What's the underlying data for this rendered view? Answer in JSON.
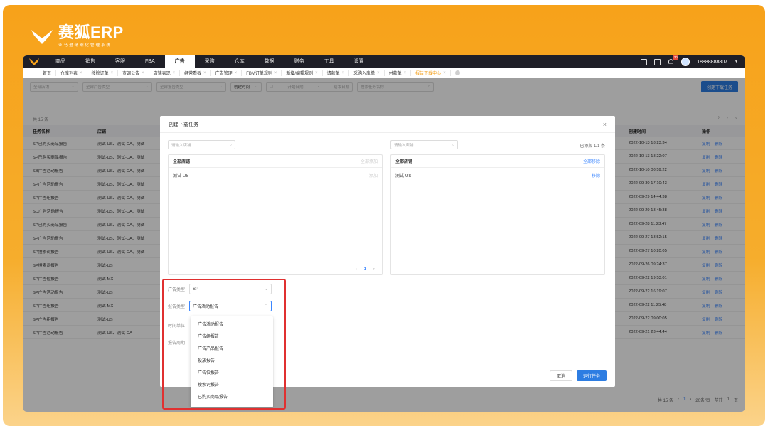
{
  "brand": {
    "name": "赛狐ERP",
    "subtitle": "亚马逊精细化管理系统"
  },
  "topnav": {
    "items": [
      {
        "label": "商品"
      },
      {
        "label": "销售"
      },
      {
        "label": "客服"
      },
      {
        "label": "FBA"
      },
      {
        "label": "广告",
        "active": true
      },
      {
        "label": "采购"
      },
      {
        "label": "仓库"
      },
      {
        "label": "数据"
      },
      {
        "label": "财务"
      },
      {
        "label": "工具"
      },
      {
        "label": "设置"
      }
    ],
    "badge_count": "30",
    "user": "18888888807"
  },
  "tabs": [
    {
      "label": "首页"
    },
    {
      "label": "仓库列表"
    },
    {
      "label": "移除订单"
    },
    {
      "label": "查调公告"
    },
    {
      "label": "店铺表现"
    },
    {
      "label": "经营看板"
    },
    {
      "label": "广告管理"
    },
    {
      "label": "FBM订单规则"
    },
    {
      "label": "新增/编辑规则"
    },
    {
      "label": "请款单"
    },
    {
      "label": "采购入库单"
    },
    {
      "label": "付款单"
    },
    {
      "label": "报告下载中心",
      "active": true
    }
  ],
  "filters": {
    "shop": "全部店铺",
    "ad_type": "全部广告类型",
    "report_type": "全部报告类型",
    "time_type": "创建时间",
    "start": "开始日期",
    "end": "结束日期",
    "search_placeholder": "搜索任务名称",
    "create_button": "创建下载任务"
  },
  "table": {
    "total": "共 15 条",
    "headers": {
      "name": "任务名称",
      "shop": "店铺",
      "time": "创建时间",
      "op": "操作"
    },
    "rows": [
      {
        "name": "SP已购买商品报告",
        "shop": "测试-US、测试-CA、测试",
        "time": "2022-10-13 18:23:34"
      },
      {
        "name": "SP已购买商品报告",
        "shop": "测试-US、测试-CA、测试",
        "time": "2022-10-13 18:22:07"
      },
      {
        "name": "SB广告活动报告",
        "shop": "测试-US、测试-CA、测试",
        "time": "2022-10-10 08:59:22"
      },
      {
        "name": "SP广告活动报告",
        "shop": "测试-US、测试-CA、测试",
        "time": "2022-09-30 17:10:43"
      },
      {
        "name": "SP广告组报告",
        "shop": "测试-US、测试-CA、测试",
        "time": "2022-09-29 14:44:38"
      },
      {
        "name": "SD广告活动报告",
        "shop": "测试-US、测试-CA、测试",
        "time": "2022-09-29 13:45:38"
      },
      {
        "name": "SP已购买商品报告",
        "shop": "测试-US、测试-CA、测试",
        "time": "2022-09-28 11:23:47"
      },
      {
        "name": "SP广告活动报告",
        "shop": "测试-US、测试-CA、测试",
        "time": "2022-09-27 13:52:15"
      },
      {
        "name": "SP搜索词报告",
        "shop": "测试-US、测试-CA、测试",
        "time": "2022-09-27 10:20:05"
      },
      {
        "name": "SP搜索词报告",
        "shop": "测试-US",
        "time": "2022-09-26 09:24:37"
      },
      {
        "name": "SP广告位报告",
        "shop": "测试-MX",
        "time": "2022-09-22 19:53:01"
      },
      {
        "name": "SP广告活动报告",
        "shop": "测试-US",
        "time": "2022-09-22 16:19:07"
      },
      {
        "name": "SP广告组报告",
        "shop": "测试-MX",
        "time": "2022-09-22 11:25:48"
      },
      {
        "name": "SP广告组报告",
        "shop": "测试-US",
        "time": "2022-09-22 09:00:05"
      },
      {
        "name": "SP广告活动报告",
        "shop": "测试-US、测试-CA",
        "time": "2022-09-21 23:44:44"
      }
    ],
    "op_copy": "复制",
    "op_delete": "删除"
  },
  "footer": {
    "total": "共 15 条",
    "page": "1",
    "page_size": "20条/页",
    "goto": "前往",
    "goto_page": "1",
    "goto_suffix": "页"
  },
  "modal": {
    "title": "创建下载任务",
    "left": {
      "search_placeholder": "请输入店铺",
      "header": "全部店铺",
      "header_action": "全部添加",
      "rows": [
        {
          "name": "测试-US",
          "action": "添加"
        }
      ],
      "page": "1"
    },
    "right": {
      "search_placeholder": "请输入店铺",
      "added_info": "已添加 1/1 条",
      "header": "全部店铺",
      "header_action": "全部移除",
      "rows": [
        {
          "name": "测试-US",
          "action": "移除"
        }
      ]
    },
    "form": {
      "ad_type_label": "广告类型",
      "ad_type_value": "SP",
      "report_type_label": "报告类型",
      "report_type_value": "广告活动报告",
      "time_unit_label": "时间单位",
      "period_label": "报告周期"
    },
    "dropdown_options": [
      "广告活动报告",
      "广告组报告",
      "广告产品报告",
      "投放报告",
      "广告位报告",
      "搜索词报告",
      "已购买商品报告"
    ],
    "cancel": "取消",
    "run": "运行任务"
  },
  "colors": {
    "accent": "#2d7de2",
    "brand_orange": "#f7a21a",
    "highlight": "#e03030"
  }
}
